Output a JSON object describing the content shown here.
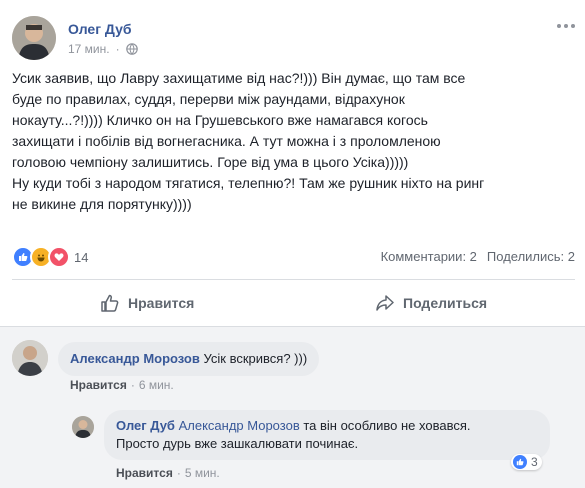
{
  "post": {
    "author": "Олег Дуб",
    "time": "17 мин.",
    "privacy_icon": "globe-icon",
    "more_icon": "more-options-icon",
    "lines": [
      "Усик заявив, що Лавру захищатиме від нас?!))) Він думає, що там все",
      "буде по правилах, суддя, перерви між раундами, відрахунок",
      "нокауту...?!)))) Кличко он на Грушевського вже намагався когось",
      "захищати і побілів від вогнегасника. А тут можна і з проломленою",
      "головою чемпіону залишитись. Горе від ума в цього Усіка)))))",
      "Ну куди тобі з народом тягатися, телепню?! Там же рушник ніхто на ринг",
      "не викине для порятунку))))"
    ],
    "reactions": {
      "icons": [
        "like-icon",
        "haha-icon",
        "love-icon"
      ],
      "count": "14"
    },
    "comments_count": "Комментарии: 2",
    "shares_count": "Поделились: 2",
    "like_button": "Нравится",
    "share_button": "Поделиться"
  },
  "comments": [
    {
      "author": "Александр Морозов",
      "text": "Усік вскрився? )))",
      "action": "Нравится",
      "separator": "·",
      "time": "6 мин."
    }
  ],
  "reply": {
    "author": "Олег Дуб",
    "mention": "Александр Морозов",
    "text_line1": " та він особливо не ховався.",
    "text_line2": "Просто дурь вже зашкалювати починає.",
    "action": "Нравится",
    "separator": "·",
    "time": "5 мин.",
    "reaction_count": "3"
  },
  "colors": {
    "link": "#385898",
    "muted": "#90949c",
    "like": "#4080ff",
    "haha": "#f7b125",
    "love": "#f25268"
  }
}
